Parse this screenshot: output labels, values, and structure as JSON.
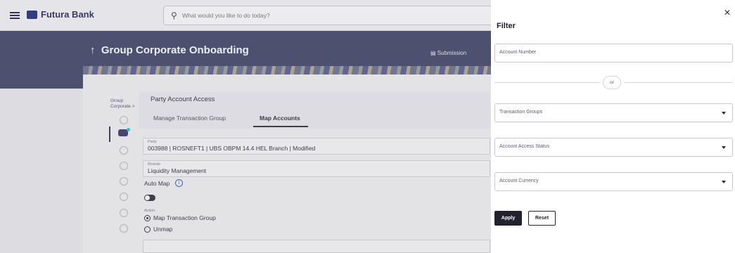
{
  "app": {
    "brand": "Futura Bank",
    "search_placeholder": "What would you like to do today?"
  },
  "banner": {
    "title": "Group Corporate Onboarding",
    "submission_text": "Submission"
  },
  "breadcrumb": {
    "label": "Group Corporate >"
  },
  "party_access": {
    "title": "Party Account Access",
    "tabs": [
      {
        "label": "Manage Transaction Group",
        "active": false
      },
      {
        "label": "Map Accounts",
        "active": true
      }
    ],
    "party_label": "Party",
    "party_value": "003988 | ROSNEFT1 | UBS OBPM 14.4 HEL Branch | Modified",
    "module_label": "Module",
    "module_value": "Liquidity Management",
    "auto_map_label": "Auto Map",
    "action_label": "Action",
    "action_options": [
      {
        "label": "Map Transaction Group",
        "selected": true
      },
      {
        "label": "Unmap",
        "selected": false
      }
    ]
  },
  "filter": {
    "title": "Filter",
    "account_number_placeholder": "Account Number",
    "or_text": "or",
    "transaction_groups": "Transaction Groups",
    "account_access_status": "Account Access Status",
    "account_currency": "Account Currency",
    "apply_label": "Apply",
    "reset_label": "Reset"
  },
  "colors": {
    "banner": "#3d4366",
    "dark_button": "#22222e",
    "accent_dot": "#2fc4b4"
  }
}
